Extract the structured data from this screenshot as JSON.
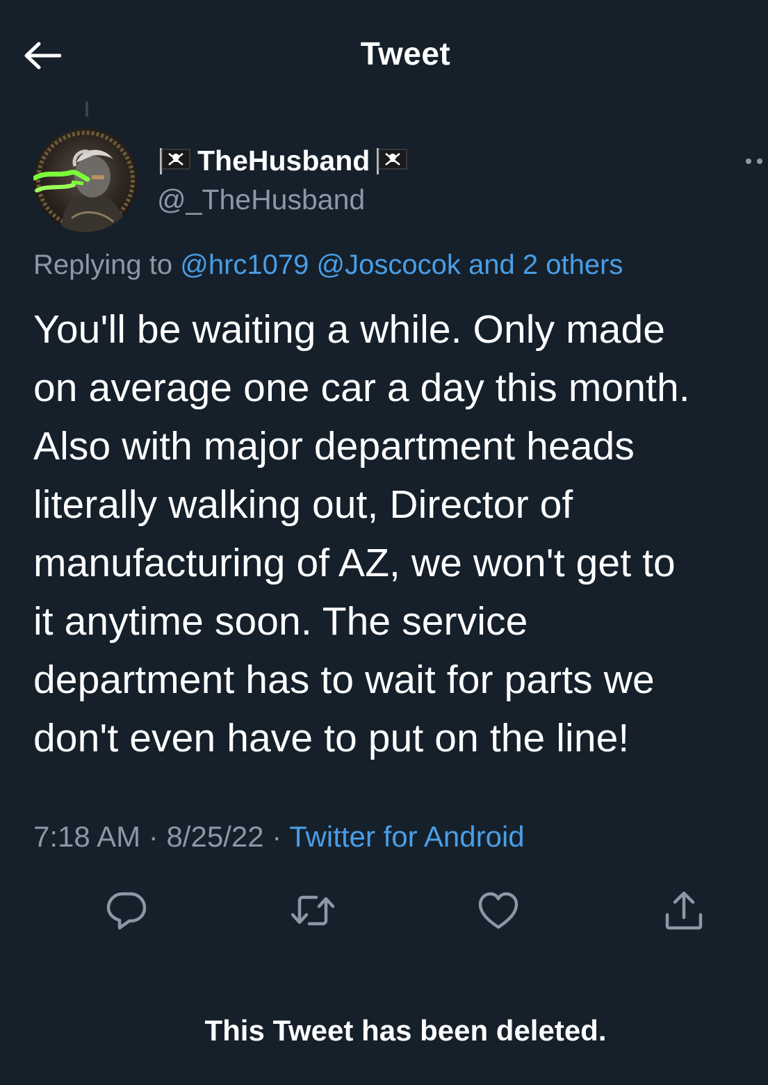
{
  "header": {
    "title": "Tweet",
    "back_icon": "arrow-left-icon"
  },
  "author": {
    "display_name": "TheHusband",
    "handle": "@_TheHusband",
    "flag_icon": "pirate-flag-icon"
  },
  "reply": {
    "prefix": "Replying to",
    "mention_1": "@hrc1079",
    "mention_2": "@Joscocok",
    "others": "and 2 others"
  },
  "tweet": {
    "lines": [
      "You'll be waiting a while. Only made",
      "on average one car a day this month.",
      "Also with major department heads",
      "literally walking out, Director of",
      "manufacturing of AZ, we won't get to",
      "it anytime soon. The service",
      "department has to wait for parts we",
      "don't even have to put on the line!"
    ]
  },
  "meta": {
    "time": "7:18 AM",
    "separator": "·",
    "date": "8/25/22",
    "source": "Twitter for Android"
  },
  "actions": {
    "icons": [
      "reply-icon",
      "retweet-icon",
      "like-icon",
      "share-icon"
    ]
  },
  "footer": {
    "deleted_notice": "This Tweet has been deleted."
  },
  "colors": {
    "background": "#15202b",
    "text": "#ffffff",
    "secondary": "#8b98a5",
    "link": "#4a9ee6"
  }
}
